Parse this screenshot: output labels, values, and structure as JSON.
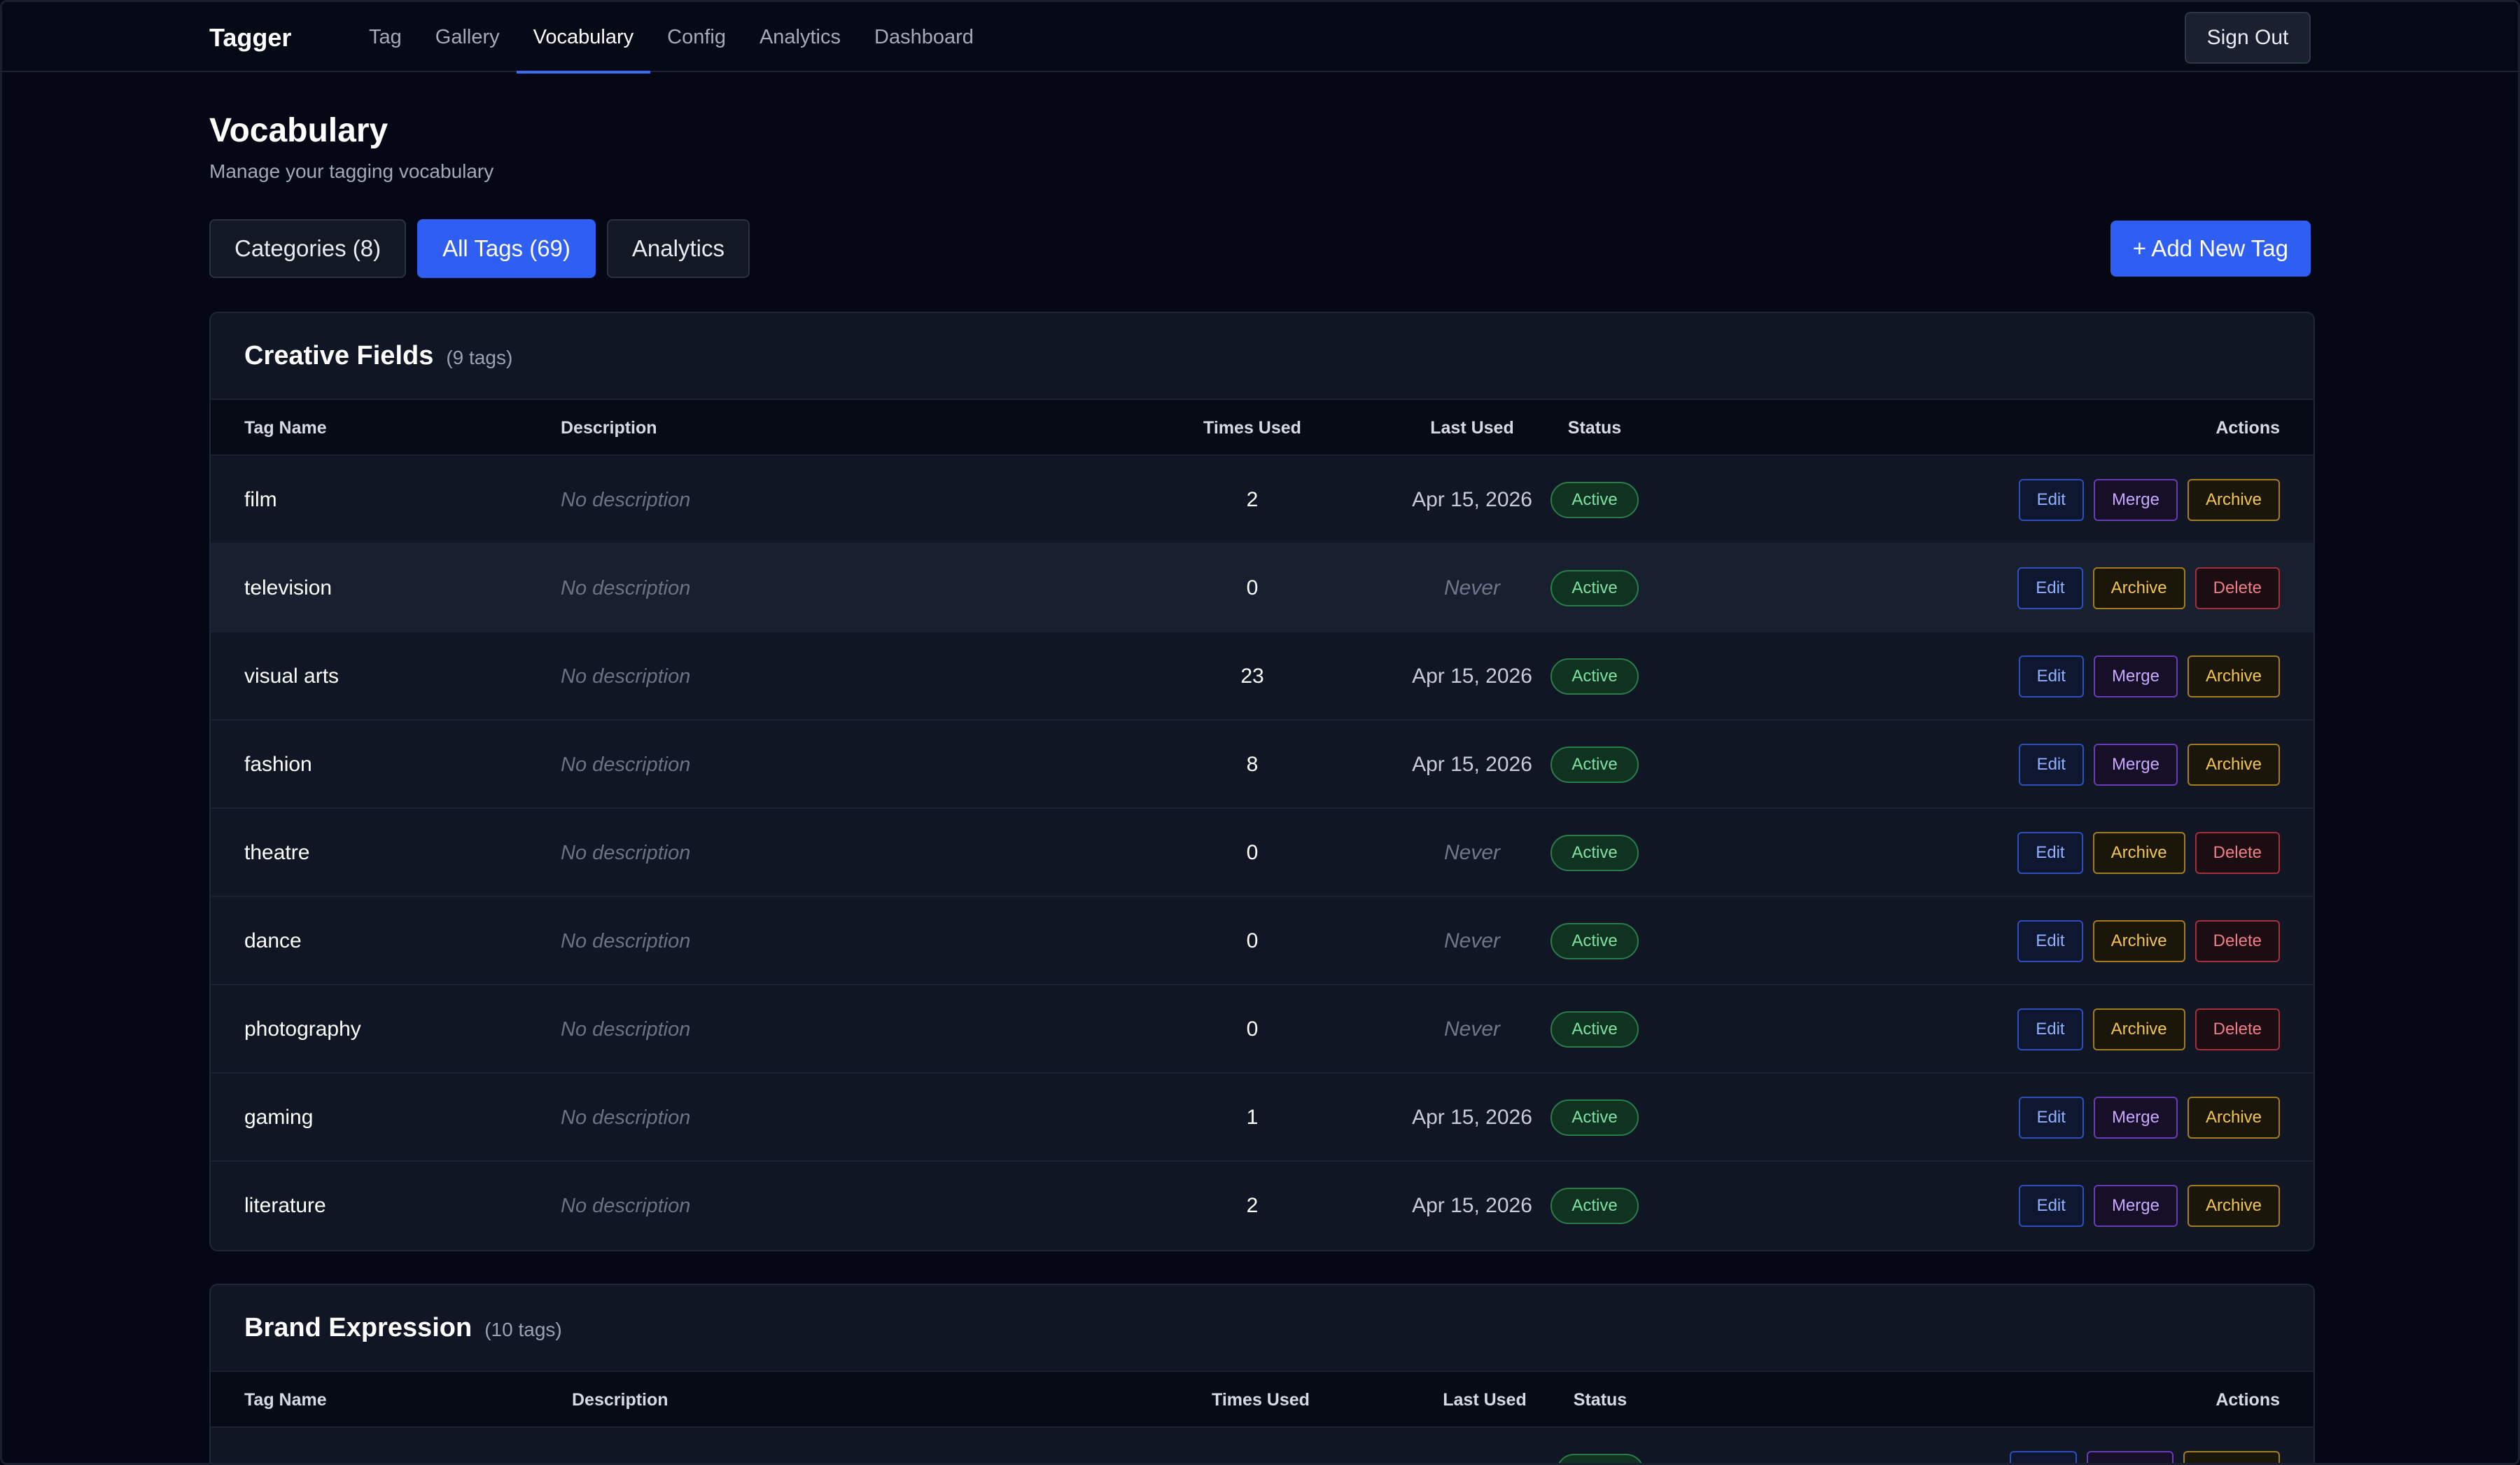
{
  "nav": {
    "brand": "Tagger",
    "links": [
      "Tag",
      "Gallery",
      "Vocabulary",
      "Config",
      "Analytics",
      "Dashboard"
    ],
    "active": "Vocabulary",
    "signout_label": "Sign Out"
  },
  "header": {
    "title": "Vocabulary",
    "subtitle": "Manage your tagging vocabulary"
  },
  "tabs": [
    {
      "label": "Categories (8)",
      "active": false
    },
    {
      "label": "All Tags (69)",
      "active": true
    },
    {
      "label": "Analytics",
      "active": false
    }
  ],
  "add_tag_label": "+ Add New Tag",
  "table_headers": {
    "name": "Tag Name",
    "description": "Description",
    "times": "Times Used",
    "last": "Last Used",
    "status": "Status",
    "actions": "Actions"
  },
  "categories": [
    {
      "title": "Creative Fields",
      "count": "(9 tags)",
      "rows": [
        {
          "name": "film",
          "description": "No description",
          "times": "2",
          "last": "Apr 15, 2026",
          "status": "Active",
          "actions": [
            "Edit",
            "Merge",
            "Archive"
          ]
        },
        {
          "name": "television",
          "description": "No description",
          "times": "0",
          "last": "Never",
          "status": "Active",
          "actions": [
            "Edit",
            "Archive",
            "Delete"
          ]
        },
        {
          "name": "visual arts",
          "description": "No description",
          "times": "23",
          "last": "Apr 15, 2026",
          "status": "Active",
          "actions": [
            "Edit",
            "Merge",
            "Archive"
          ]
        },
        {
          "name": "fashion",
          "description": "No description",
          "times": "8",
          "last": "Apr 15, 2026",
          "status": "Active",
          "actions": [
            "Edit",
            "Merge",
            "Archive"
          ]
        },
        {
          "name": "theatre",
          "description": "No description",
          "times": "0",
          "last": "Never",
          "status": "Active",
          "actions": [
            "Edit",
            "Archive",
            "Delete"
          ]
        },
        {
          "name": "dance",
          "description": "No description",
          "times": "0",
          "last": "Never",
          "status": "Active",
          "actions": [
            "Edit",
            "Archive",
            "Delete"
          ]
        },
        {
          "name": "photography",
          "description": "No description",
          "times": "0",
          "last": "Never",
          "status": "Active",
          "actions": [
            "Edit",
            "Archive",
            "Delete"
          ]
        },
        {
          "name": "gaming",
          "description": "No description",
          "times": "1",
          "last": "Apr 15, 2026",
          "status": "Active",
          "actions": [
            "Edit",
            "Merge",
            "Archive"
          ]
        },
        {
          "name": "literature",
          "description": "No description",
          "times": "2",
          "last": "Apr 15, 2026",
          "status": "Active",
          "actions": [
            "Edit",
            "Merge",
            "Archive"
          ]
        }
      ]
    },
    {
      "title": "Brand Expression",
      "count": "(10 tags)",
      "rows": []
    }
  ],
  "colors": {
    "accent": "#2f5ff2",
    "active_badge": "#7ee2a3",
    "edit": "#8fb1ff",
    "merge": "#caa7ff",
    "archive": "#f3c54c",
    "delete": "#f27c86"
  }
}
